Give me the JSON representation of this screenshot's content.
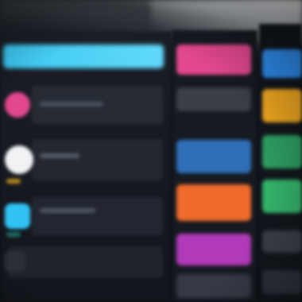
{
  "app": {
    "theme": "dark",
    "accent_colors": {
      "cyan": "#48cdf4",
      "pink": "#e2488e",
      "blue": "#2f8ef0",
      "orange": "#f29a1c",
      "green": "#2fb36a",
      "purple": "#a23cc9"
    }
  },
  "left_list": {
    "header_color": "#48cdf4",
    "items": [
      {
        "icon": "pink-app-icon",
        "icon_color": "#e2488e"
      },
      {
        "icon": "white-app-icon",
        "icon_color": "#f2f2f4"
      },
      {
        "icon": "cyan-app-icon",
        "icon_color": "#31c2f3"
      },
      {
        "icon": "dark-app-icon",
        "icon_color": "#2a2f38"
      }
    ]
  },
  "grid": {
    "columns": [
      {
        "tiles": [
          {
            "icon": "pink-tile",
            "color": "#e2488e"
          },
          {
            "icon": "gray-tile",
            "color": "#3a3f48"
          },
          {
            "icon": "blue-tile",
            "color": "#2f6fb8"
          },
          {
            "icon": "orange-tile",
            "color": "#ef6b2c"
          },
          {
            "icon": "purple-tile",
            "color": "#b13ab8"
          },
          {
            "icon": "gray-tile",
            "color": "#343944"
          }
        ]
      },
      {
        "tiles": [
          {
            "icon": "blue-tile",
            "color": "#2f8ef0"
          },
          {
            "icon": "yellow-tile",
            "color": "#f0a821"
          },
          {
            "icon": "green-tile",
            "color": "#2e9e62"
          },
          {
            "icon": "green-tile",
            "color": "#35b56b"
          },
          {
            "icon": "gray-tile",
            "color": "#3a3f48"
          },
          {
            "icon": "gray-tile",
            "color": "#2c313b"
          }
        ]
      }
    ]
  }
}
